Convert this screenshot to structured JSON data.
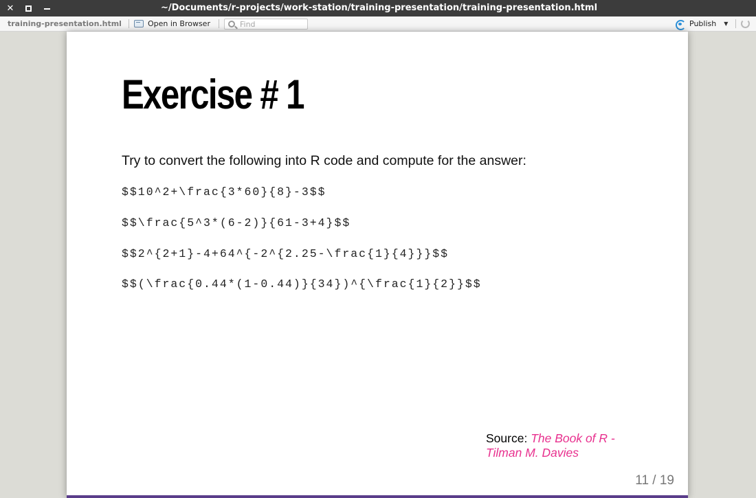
{
  "window": {
    "title": "~/Documents/r-projects/work-station/training-presentation/training-presentation.html",
    "controls": {
      "close": "✕"
    }
  },
  "toolbar": {
    "filename": "training-presentation.html",
    "open_in_browser": "Open in Browser",
    "find_placeholder": "Find",
    "publish": "Publish"
  },
  "slide": {
    "title": "Exercise # 1",
    "intro": "Try to convert the following into R code and compute for the answer:",
    "formulas": [
      "$$10^2+\\frac{3*60}{8}-3$$",
      "$$\\frac{5^3*(6-2)}{61-3+4}$$",
      "$$2^{2+1}-4+64^{-2^{2.25-\\frac{1}{4}}}$$",
      "$$(\\frac{0.44*(1-0.44)}{34})^{\\frac{1}{2}}$$"
    ],
    "source_label": "Source:",
    "source_link": "The Book of R - Tilman M. Davies",
    "page": "11 / 19"
  },
  "colors": {
    "accent_link": "#e8308e",
    "bottom_bar": "#5a3d8a",
    "titlebar": "#3c3c3c"
  }
}
